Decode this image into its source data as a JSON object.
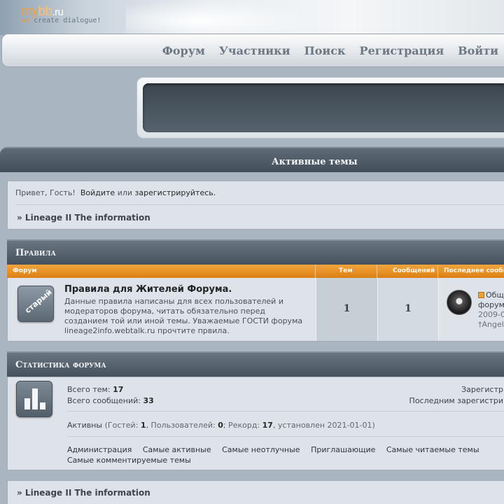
{
  "header": {
    "logo": {
      "my": "my",
      "bb": "bb",
      "ru": ".ru",
      "tag_we": "we",
      "tag_rest": "create dialogue!"
    },
    "nav": [
      "Форум",
      "Участники",
      "Поиск",
      "Регистрация",
      "Войти"
    ]
  },
  "active_topics": "Активные темы",
  "greeting": {
    "hello": "Привет, Гость!",
    "login": "Войдите",
    "or": "или",
    "register": "зарегистрируйтесь."
  },
  "breadcrumb": "» Lineage II The information",
  "rules": {
    "title": "Правила",
    "columns": [
      "Форум",
      "Тем",
      "Сообщений",
      "Последнее сообщение"
    ],
    "forum": {
      "icon_label": "старый",
      "name": "Правила для Жителей Форума.",
      "description": "Данные правила написаны для всех пользователей и модераторов форума, читать обязательно перед созданием той или иной темы. Уважаемые ГОСТИ форума lineage2info.webtalk.ru прочтите првила.",
      "topics": "1",
      "posts": "1",
      "last_post": {
        "title": "Общ",
        "title2": "форум",
        "date": "2009-0",
        "author": "†Angel"
      }
    }
  },
  "stats": {
    "title": "Статистика форума",
    "total_topics_label": "Всего тем:",
    "total_topics": "17",
    "total_posts_label": "Всего сообщений:",
    "total_posts": "33",
    "registered_label": "Зарегистр",
    "last_registered_label": "Последним зарегистри",
    "online": {
      "label": "Активны",
      "guests_label": "(Гостей:",
      "guests": "1",
      "users_label": ", Пользователей:",
      "users": "0",
      "record_label": "; Рекорд:",
      "record": "17",
      "set_label": ", установлен 2021-01-01)"
    },
    "links": [
      "Администрация",
      "Самые активные",
      "Самые неотлучные",
      "Приглашающие",
      "Самые читаемые темы",
      "Самые комментируемые темы"
    ]
  }
}
